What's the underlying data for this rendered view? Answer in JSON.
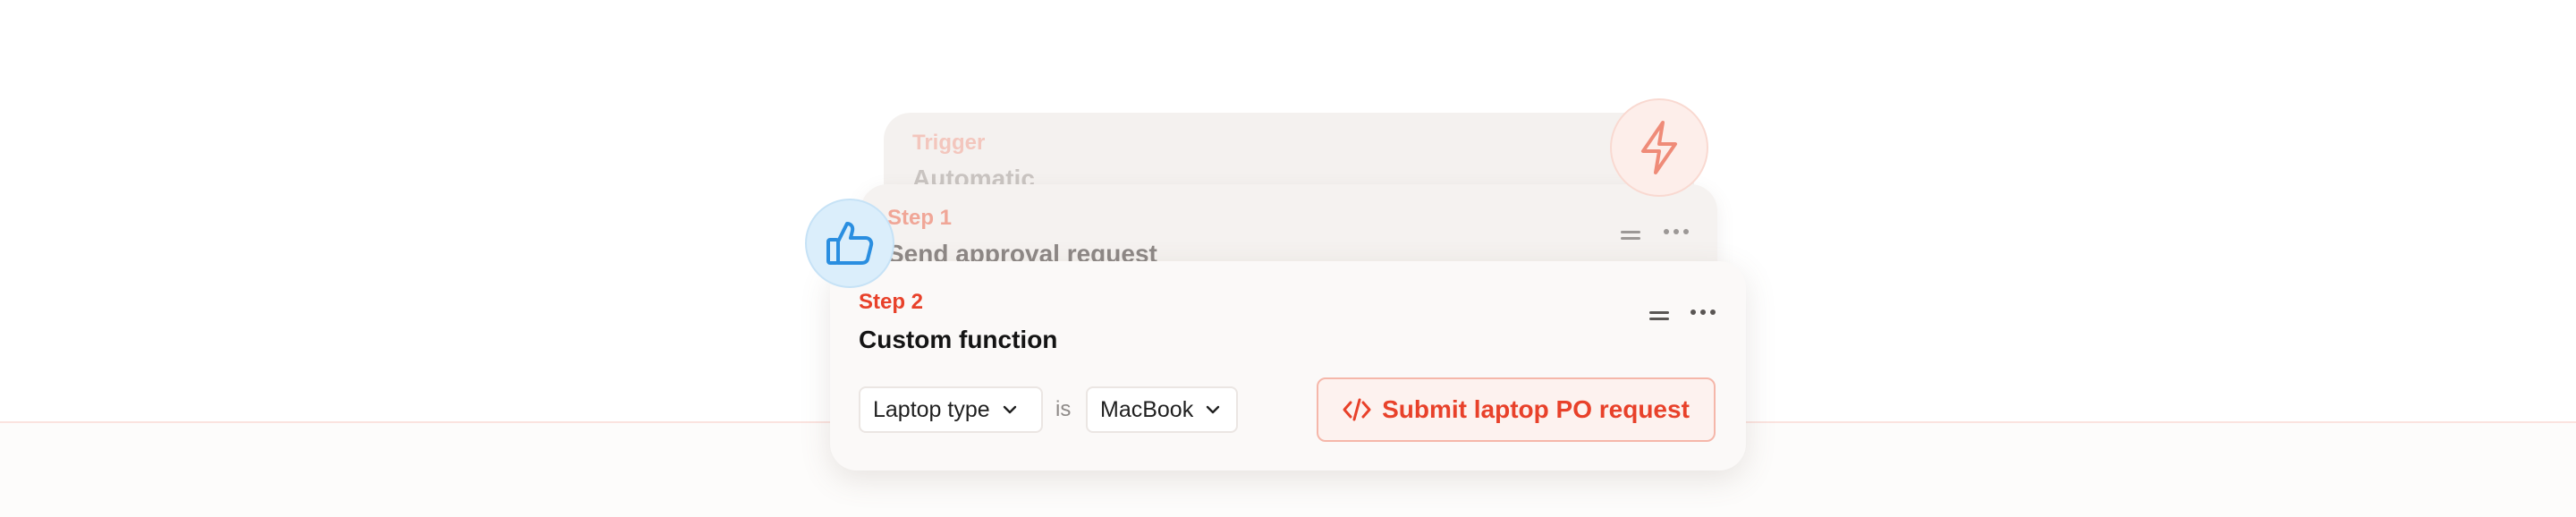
{
  "trigger": {
    "label": "Trigger",
    "value": "Automatic"
  },
  "step1": {
    "label": "Step 1",
    "title": "Send approval request"
  },
  "step2": {
    "label": "Step 2",
    "title": "Custom function",
    "condition": {
      "field": "Laptop type",
      "operator": "is",
      "value": "MacBook"
    },
    "action_label": "Submit laptop PO request"
  },
  "icons": {
    "trigger": "lightning-bolt-icon",
    "approval": "thumbs-up-icon",
    "action": "code-icon",
    "drag": "drag-handle-icon",
    "more": "more-options-icon",
    "dropdown": "chevron-down-icon"
  },
  "colors": {
    "accent": "#e8412a",
    "approval_blue": "#2a8ee0",
    "trigger_accent": "#ef8b78"
  }
}
